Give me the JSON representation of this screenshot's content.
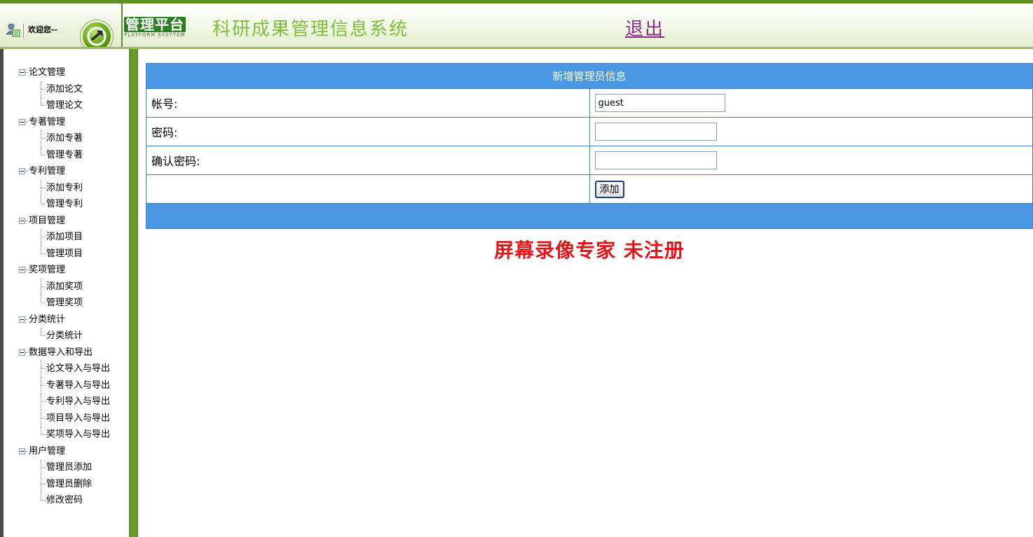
{
  "header": {
    "welcome_text": "欢迎您--",
    "platform_title": "管理平台",
    "platform_subtitle": "PLATFORM SYSYTEM",
    "system_title": "科研成果管理信息系统",
    "logout_label": "退出"
  },
  "sidebar": {
    "groups": [
      {
        "label": "论文管理",
        "items": [
          "添加论文",
          "管理论文"
        ]
      },
      {
        "label": "专著管理",
        "items": [
          "添加专著",
          "管理专著"
        ]
      },
      {
        "label": "专利管理",
        "items": [
          "添加专利",
          "管理专利"
        ]
      },
      {
        "label": "项目管理",
        "items": [
          "添加项目",
          "管理项目"
        ]
      },
      {
        "label": "奖项管理",
        "items": [
          "添加奖项",
          "管理奖项"
        ]
      },
      {
        "label": "分类统计",
        "items": [
          "分类统计"
        ]
      },
      {
        "label": "数据导入和导出",
        "items": [
          "论文导入与导出",
          "专著导入与导出",
          "专利导入与导出",
          "项目导入与导出",
          "奖项导入与导出"
        ]
      },
      {
        "label": "用户管理",
        "items": [
          "管理员添加",
          "管理员删除",
          "修改密码"
        ]
      }
    ]
  },
  "form": {
    "title": "新增管理员信息",
    "account_label": "帐号:",
    "account_value": "guest",
    "password_label": "密码:",
    "password_value": "",
    "confirm_label": "确认密码:",
    "confirm_value": "",
    "submit_label": "添加"
  },
  "watermark": "屏幕录像专家  未注册",
  "colors": {
    "header_green": "#5f8f2a",
    "title_green": "#7cc03a",
    "table_blue": "#4a97e4",
    "watermark_red": "#e0161b",
    "logout_purple": "#8a2b8a"
  }
}
